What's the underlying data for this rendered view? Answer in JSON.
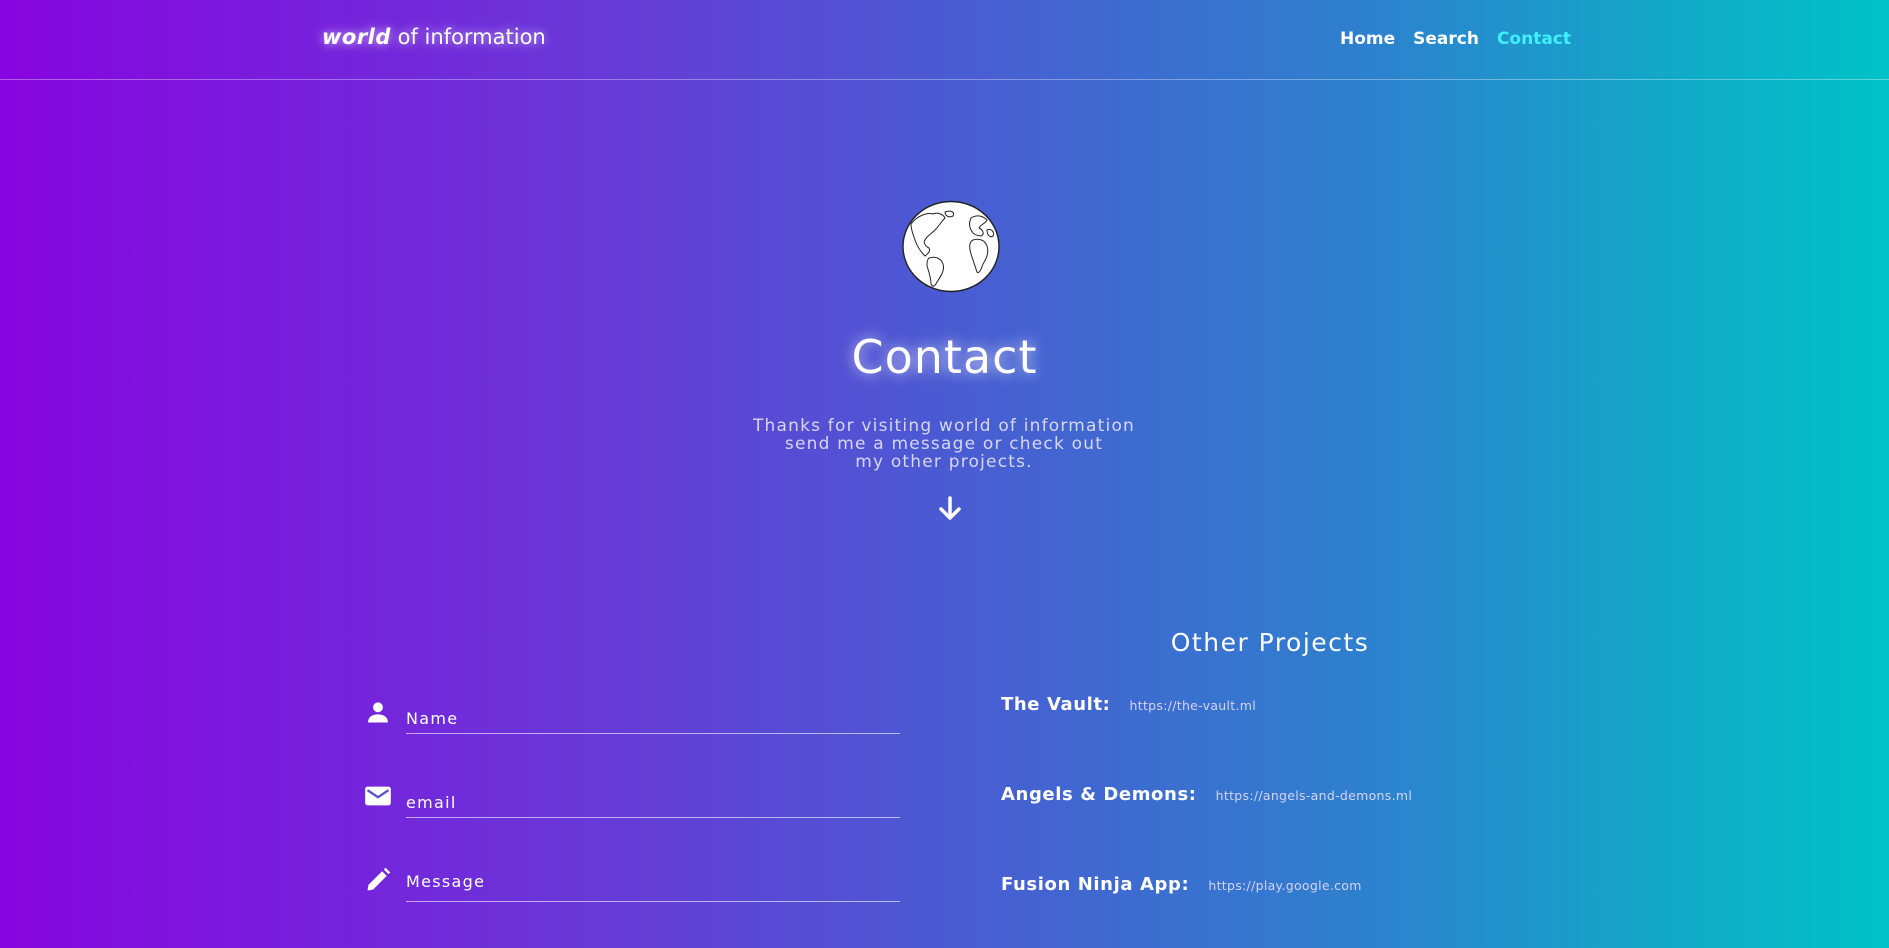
{
  "header": {
    "brand_bold": "world",
    "brand_light": "of information",
    "nav": [
      {
        "label": "Home"
      },
      {
        "label": "Search"
      },
      {
        "label": "Contact",
        "active": true
      }
    ]
  },
  "hero": {
    "title": "Contact",
    "lines": [
      "Thanks for visiting world of information",
      "send me a message or check out",
      "my other projects."
    ]
  },
  "form": {
    "name_placeholder": "Name",
    "email_placeholder": "email",
    "message_placeholder": "Message"
  },
  "projects": {
    "title": "Other Projects",
    "items": [
      {
        "name": "The Vault:",
        "url": "https://the-vault.ml"
      },
      {
        "name": "Angels & Demons:",
        "url": "https://angels-and-demons.ml"
      },
      {
        "name": "Fusion Ninja App:",
        "url": "https://play.google.com"
      }
    ]
  },
  "colors": {
    "gradient_left": "#8705e0",
    "gradient_right": "#00c2c7",
    "nav_active": "#3ff0ff"
  },
  "icons": [
    "globe-icon",
    "arrow-down-icon",
    "person-icon",
    "mail-icon",
    "pencil-icon"
  ]
}
